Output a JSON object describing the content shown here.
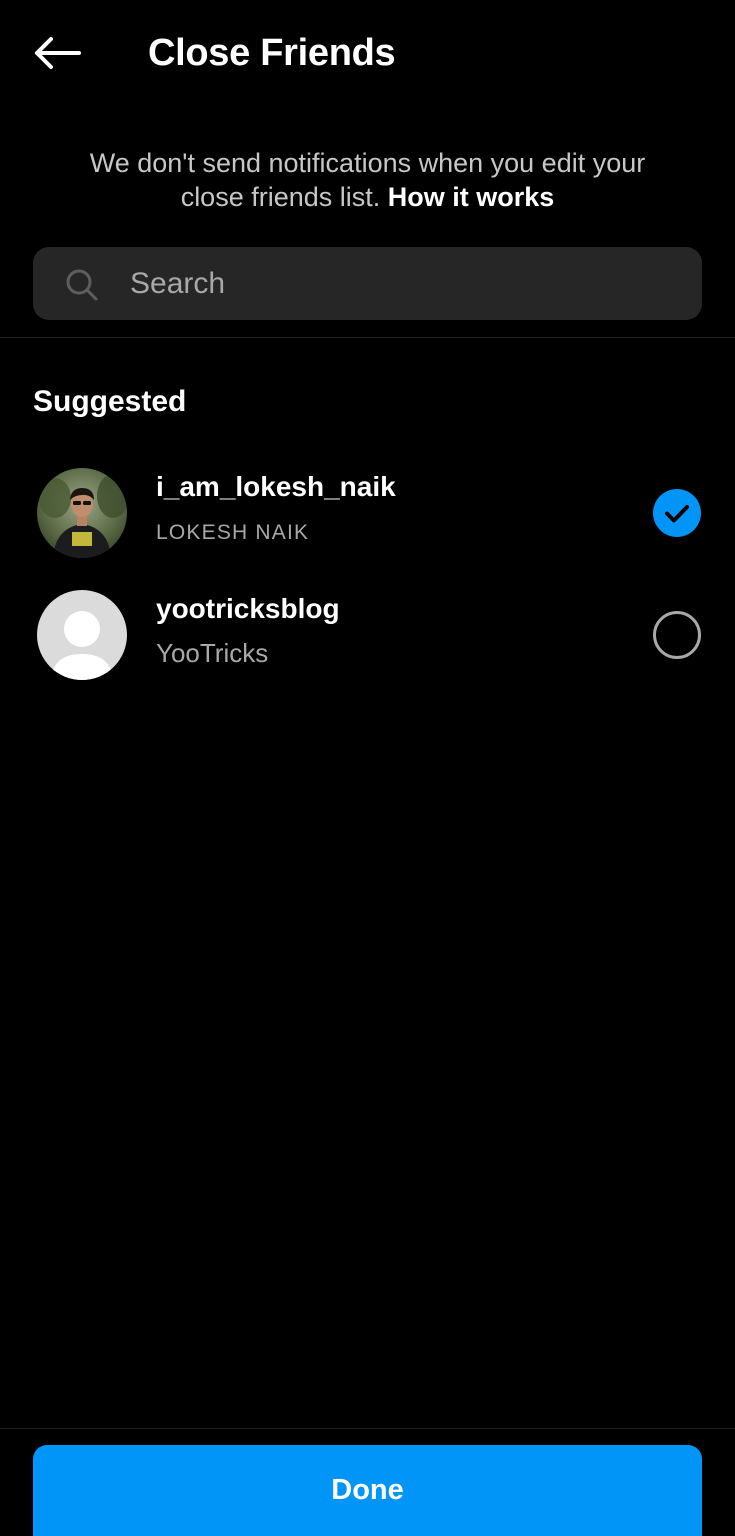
{
  "header": {
    "back_icon": "arrow-left-icon",
    "title": "Close Friends"
  },
  "notice": {
    "text": "We don't send notifications when you edit your close friends list.",
    "link_text": "How it works"
  },
  "search": {
    "icon": "search-icon",
    "placeholder": "Search",
    "value": ""
  },
  "suggested": {
    "title": "Suggested",
    "items": [
      {
        "username": "i_am_lokesh_naik",
        "full_name": "LOKESH NAIK",
        "avatar": "profile-photo",
        "selected": true
      },
      {
        "username": "yootricksblog",
        "full_name": "YooTricks",
        "avatar": "default-avatar",
        "selected": false
      }
    ]
  },
  "done_button": {
    "label": "Done"
  },
  "colors": {
    "background": "#000000",
    "accent": "#0095f6",
    "search_bg": "#262626",
    "secondary_text": "#a8a8a8"
  }
}
